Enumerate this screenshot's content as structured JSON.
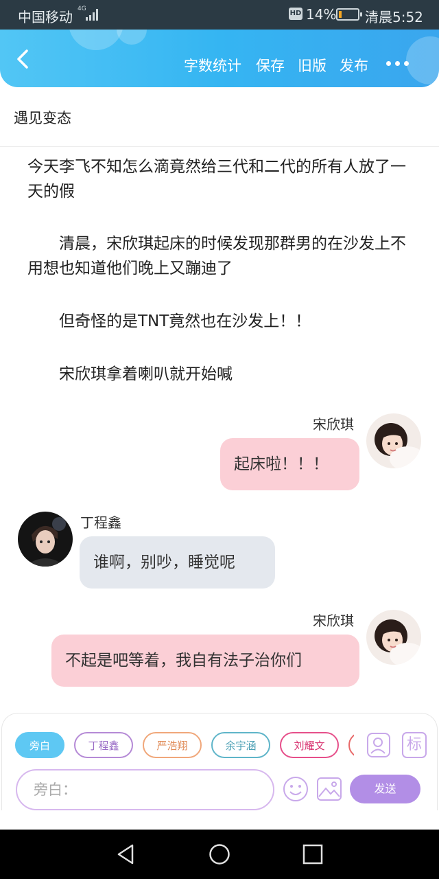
{
  "status_bar": {
    "carrier": "中国移动",
    "network": "4G",
    "hd_label": "HD",
    "battery_percent": "14%",
    "battery_level": 0.14,
    "time": "清晨5:52"
  },
  "header": {
    "nav_items": [
      "字数统计",
      "保存",
      "旧版",
      "发布"
    ],
    "back_icon": "chevron-left-icon",
    "more_icon": "more-dots-icon"
  },
  "document": {
    "title": "遇见变态",
    "paragraphs": [
      "今天李飞不知怎么滴竟然给三代和二代的所有人放了一天的假",
      "清晨，宋欣琪起床的时候发现那群男的在沙发上不用想也知道他们晚上又蹦迪了",
      "但奇怪的是TNT竟然也在沙发上！！",
      "宋欣琪拿着喇叭就开始喊"
    ]
  },
  "messages": [
    {
      "speaker": "宋欣琪",
      "text": "起床啦！！！",
      "side": "right"
    },
    {
      "speaker": "丁程鑫",
      "text": "谁啊，别吵，睡觉呢",
      "side": "left"
    },
    {
      "speaker": "宋欣琪",
      "text": "不起是吧等着，我自有法子治你们",
      "side": "right"
    }
  ],
  "bottom": {
    "chips": [
      {
        "label": "旁白",
        "color": "#5ec8f3"
      },
      {
        "label": "丁程鑫",
        "color": "#b58ad6"
      },
      {
        "label": "严浩翔",
        "color": "#f0a77a"
      },
      {
        "label": "余宇涵",
        "color": "#5fb5c9"
      },
      {
        "label": "刘耀文",
        "color": "#e64f8a"
      }
    ],
    "input_placeholder": "旁白：",
    "send_label": "发送",
    "side_icons": [
      "character-icon",
      "mark-icon"
    ],
    "side_mark_label": "标",
    "tool_icons": [
      "emoji-icon",
      "image-icon"
    ]
  },
  "system_nav": [
    "back-triangle-icon",
    "home-circle-icon",
    "recent-square-icon"
  ]
}
